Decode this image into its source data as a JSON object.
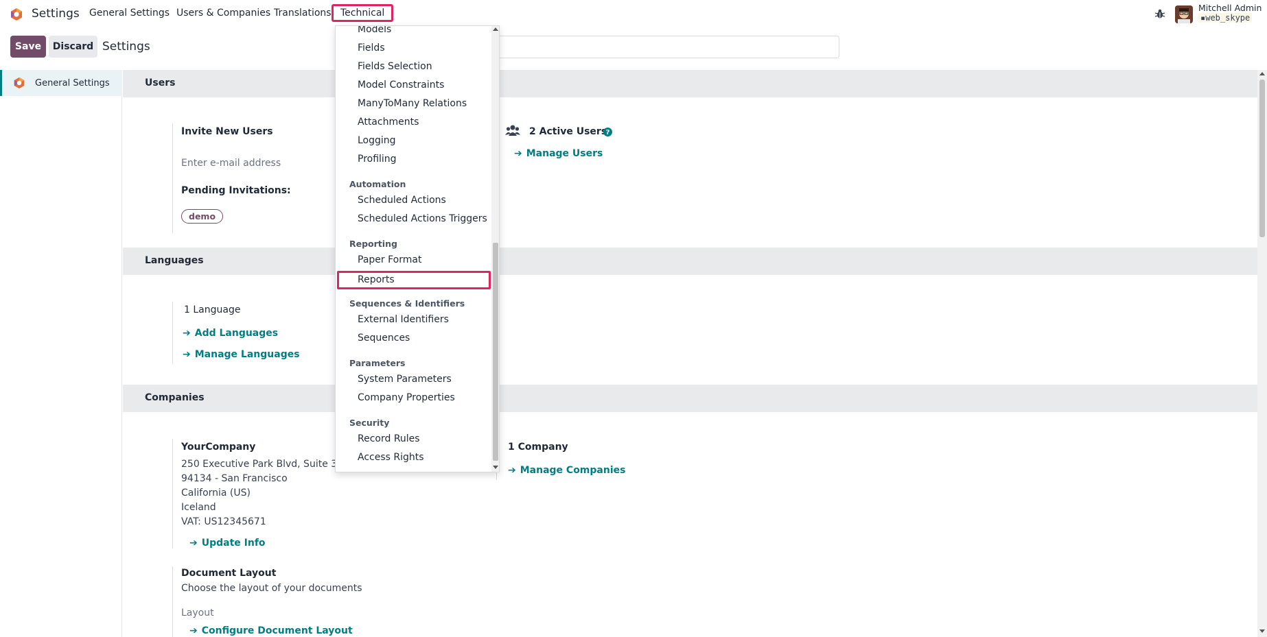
{
  "navbar": {
    "app_name": "Settings",
    "menu": [
      "General Settings",
      "Users & Companies",
      "Translations",
      "Technical"
    ],
    "user_name": "Mitchell Admin",
    "database": "web_skype"
  },
  "control_panel": {
    "save_label": "Save",
    "discard_label": "Discard",
    "title": "Settings"
  },
  "sidebar": {
    "items": [
      {
        "label": "General Settings"
      }
    ]
  },
  "sections": {
    "users": {
      "title": "Users",
      "invite_label": "Invite New Users",
      "email_placeholder": "Enter e-mail address",
      "pending_label": "Pending Invitations:",
      "pending_tag": "demo",
      "active_users": "2 Active Users",
      "manage_users": "Manage Users"
    },
    "languages": {
      "title": "Languages",
      "count": "1 Language",
      "add": "Add Languages",
      "manage": "Manage Languages"
    },
    "companies": {
      "title": "Companies",
      "company_name": "YourCompany",
      "address": [
        "250 Executive Park Blvd, Suite 3400",
        "94134 - San Francisco",
        "California (US)",
        "Iceland",
        "VAT:  US12345671"
      ],
      "update_info": "Update Info",
      "company_count": "1 Company",
      "manage_companies": "Manage Companies",
      "doc_layout_title": "Document Layout",
      "doc_layout_desc": "Choose the layout of your documents",
      "layout_label": "Layout",
      "configure_layout": "Configure Document Layout"
    }
  },
  "dropdown": {
    "items_top": [
      "Models",
      "Fields",
      "Fields Selection",
      "Model Constraints",
      "ManyToMany Relations",
      "Attachments",
      "Logging",
      "Profiling"
    ],
    "automation": {
      "header": "Automation",
      "items": [
        "Scheduled Actions",
        "Scheduled Actions Triggers"
      ]
    },
    "reporting": {
      "header": "Reporting",
      "items": [
        "Paper Format",
        "Reports"
      ]
    },
    "sequences": {
      "header": "Sequences & Identifiers",
      "items": [
        "External Identifiers",
        "Sequences"
      ]
    },
    "parameters": {
      "header": "Parameters",
      "items": [
        "System Parameters",
        "Company Properties"
      ]
    },
    "security": {
      "header": "Security",
      "items": [
        "Record Rules",
        "Access Rights"
      ]
    }
  },
  "colors": {
    "primary": "#714b67",
    "link": "#017e84",
    "highlight": "#e0245e"
  }
}
